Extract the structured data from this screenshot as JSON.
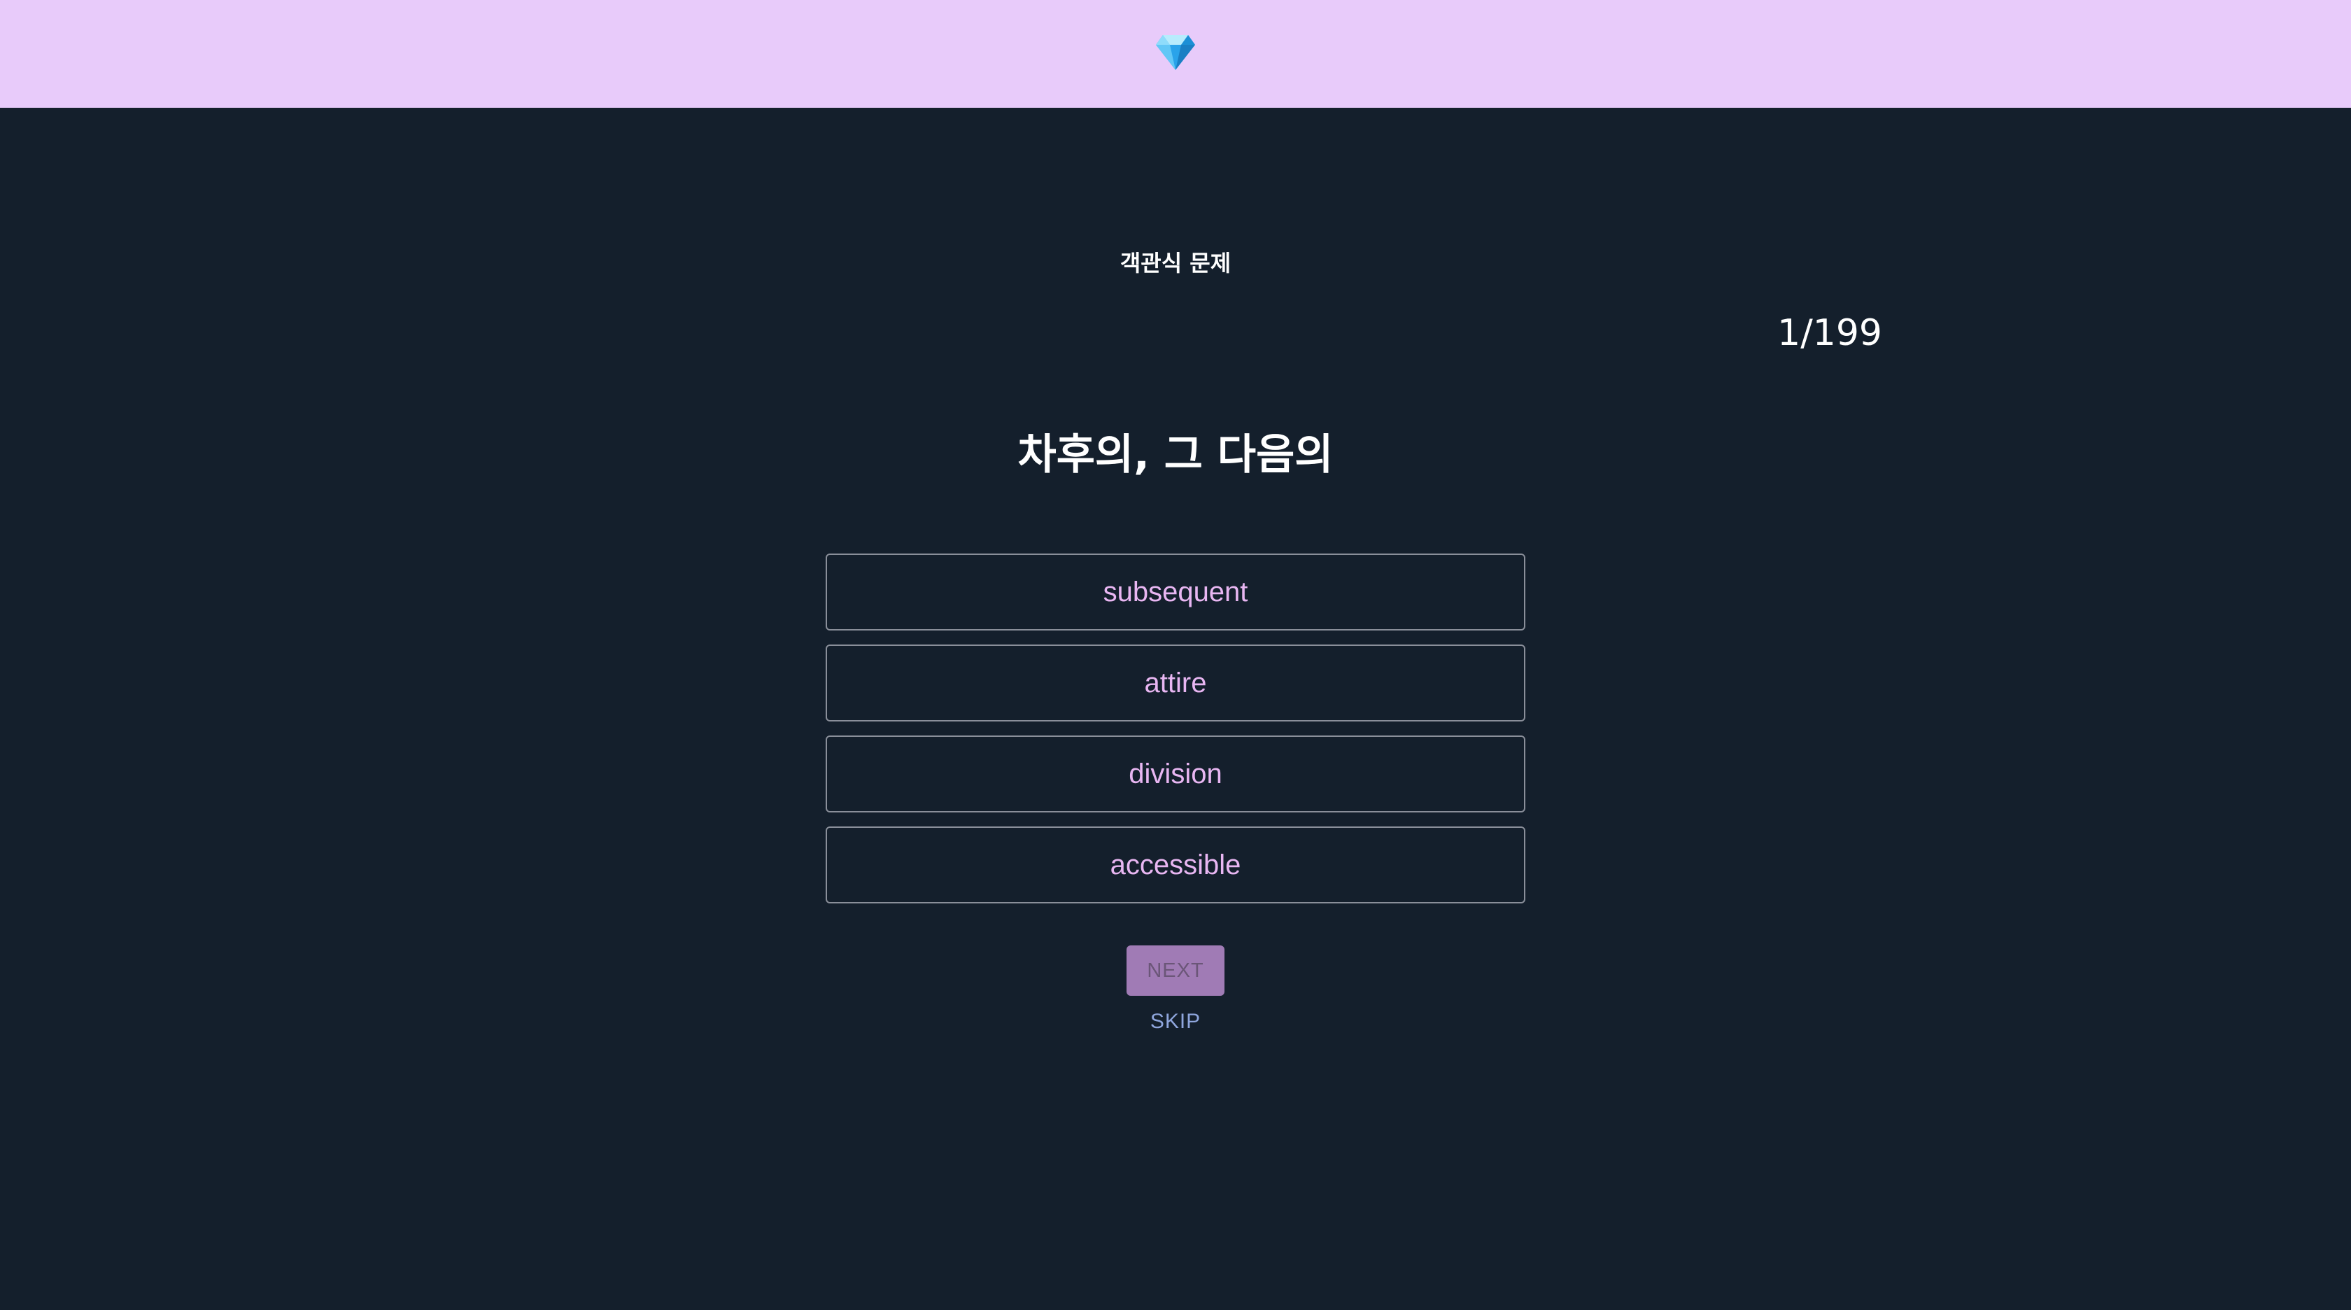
{
  "header": {
    "logo_icon": "gem-icon",
    "background_color": "#e8cbfa"
  },
  "quiz": {
    "mode_title": "객관식 문제",
    "counter": "1/199",
    "question": "차후의, 그 다음의",
    "options": [
      {
        "label": "subsequent"
      },
      {
        "label": "attire"
      },
      {
        "label": "division"
      },
      {
        "label": "accessible"
      }
    ],
    "next_label": "NEXT",
    "skip_label": "SKIP"
  },
  "colors": {
    "background": "#141f2c",
    "option_text": "#e8b6f2",
    "next_button": "#a07bb5",
    "skip_text": "#8fa6dd"
  }
}
